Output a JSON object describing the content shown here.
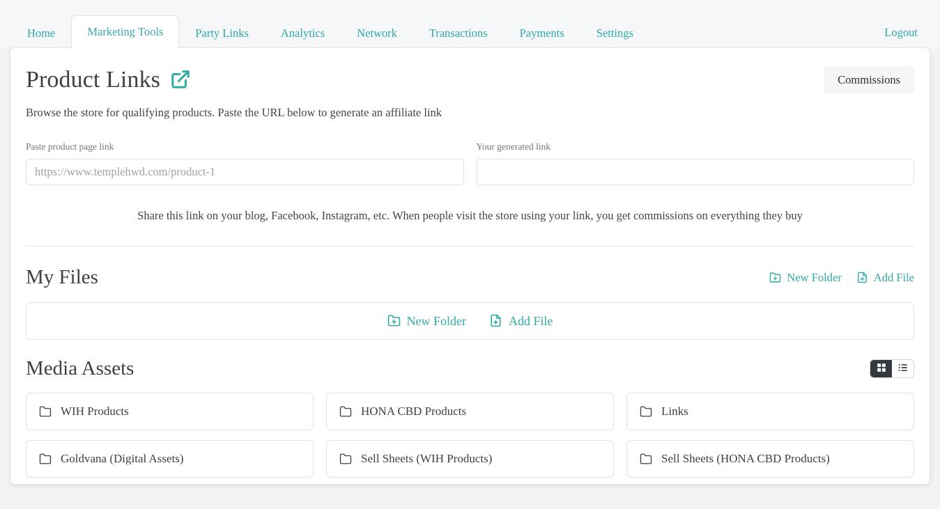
{
  "nav": {
    "tabs": [
      {
        "label": "Home",
        "active": false
      },
      {
        "label": "Marketing Tools",
        "active": true
      },
      {
        "label": "Party Links",
        "active": false
      },
      {
        "label": "Analytics",
        "active": false
      },
      {
        "label": "Network",
        "active": false
      },
      {
        "label": "Transactions",
        "active": false
      },
      {
        "label": "Payments",
        "active": false
      },
      {
        "label": "Settings",
        "active": false
      }
    ],
    "logout_label": "Logout"
  },
  "header": {
    "title": "Product Links",
    "external_link_icon": "external-link-icon",
    "commissions_label": "Commissions",
    "subtitle": "Browse the store for qualifying products. Paste the URL below to generate an affiliate link"
  },
  "form": {
    "paste_label": "Paste product page link",
    "paste_placeholder": "https://www.templehwd.com/product-1",
    "paste_value": "",
    "generated_label": "Your generated link",
    "generated_placeholder": "",
    "generated_value": "",
    "share_note": "Share this link on your blog, Facebook, Instagram, etc. When people visit the store using your link, you get commissions on everything they buy"
  },
  "my_files": {
    "title": "My Files",
    "new_folder_label": "New Folder",
    "add_file_label": "Add File",
    "new_folder_icon": "folder-plus-icon",
    "add_file_icon": "file-plus-icon",
    "box_new_folder_label": "New Folder",
    "box_add_file_label": "Add File"
  },
  "media_assets": {
    "title": "Media Assets",
    "view_modes": [
      {
        "name": "grid",
        "icon": "grid-icon",
        "active": true
      },
      {
        "name": "list",
        "icon": "list-icon",
        "active": false
      }
    ],
    "folders": [
      {
        "name": "WIH Products",
        "icon": "folder-icon"
      },
      {
        "name": "HONA CBD Products",
        "icon": "folder-icon"
      },
      {
        "name": "Links",
        "icon": "folder-icon"
      },
      {
        "name": "Goldvana (Digital Assets)",
        "icon": "folder-icon"
      },
      {
        "name": "Sell Sheets (WIH Products)",
        "icon": "folder-icon"
      },
      {
        "name": "Sell Sheets (HONA CBD Products)",
        "icon": "folder-icon"
      }
    ]
  },
  "colors": {
    "accent": "#2faaa4",
    "page_bg": "#f2f3f5",
    "card_bg": "#ffffff",
    "border": "#dfe2e5",
    "text": "#3c4146",
    "toggle_active_bg": "#343a40"
  }
}
